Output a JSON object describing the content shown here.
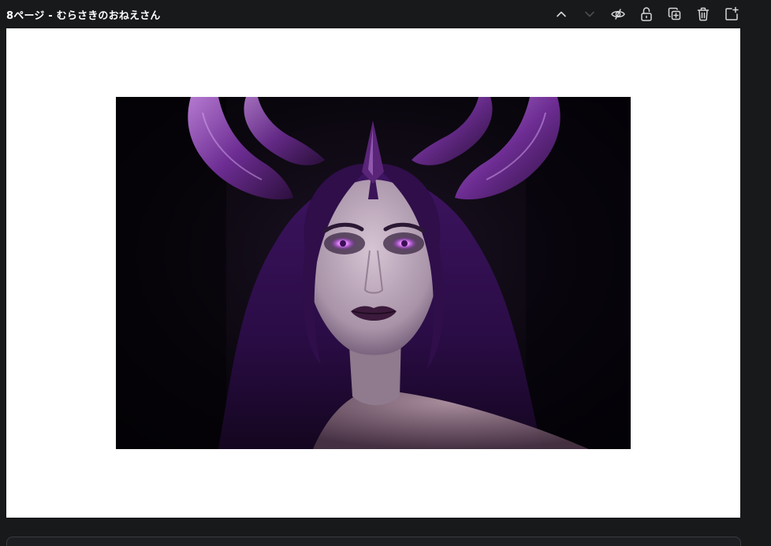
{
  "page": {
    "title": "8ページ - むらさきのおねえさん"
  },
  "toolbar": {
    "buttons": [
      {
        "name": "move-page-up-button",
        "icon": "chevron-up-icon",
        "enabled": true
      },
      {
        "name": "move-page-down-button",
        "icon": "chevron-down-icon",
        "enabled": false
      },
      {
        "name": "hide-page-button",
        "icon": "eye-slash-icon",
        "enabled": true
      },
      {
        "name": "lock-page-button",
        "icon": "unlock-icon",
        "enabled": true
      },
      {
        "name": "duplicate-page-button",
        "icon": "duplicate-icon",
        "enabled": true
      },
      {
        "name": "delete-page-button",
        "icon": "trash-icon",
        "enabled": true
      },
      {
        "name": "add-page-button",
        "icon": "add-page-icon",
        "enabled": true
      }
    ]
  },
  "canvas": {
    "background": "#ffffff",
    "image": {
      "subject": "portrait-image",
      "palette": {
        "background": "#060409",
        "hair": "#3c135c",
        "horns": "#8a3fb0",
        "skin": "#cbb7c9",
        "eyes": "#e07bff",
        "lips": "#3b1a3c"
      }
    }
  },
  "theme": {
    "app_background": "#18191b",
    "title_color": "#ffffff",
    "icon_color": "#d6d6d6",
    "panel_border": "#3a3b3f"
  }
}
